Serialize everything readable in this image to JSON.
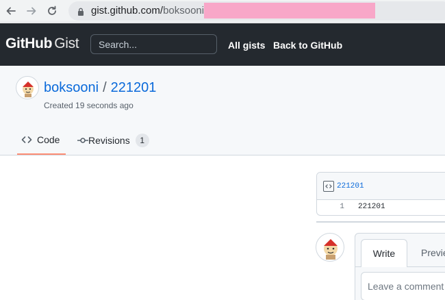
{
  "browser": {
    "url_domain": "gist.github.com/",
    "url_path": "boksooni/"
  },
  "header": {
    "logo_github": "GitHub",
    "logo_gist": "Gist",
    "search_placeholder": "Search...",
    "all_gists": "All gists",
    "back_to_github": "Back to GitHub"
  },
  "gist": {
    "owner": "boksooni",
    "separator": "/",
    "name": "221201",
    "created": "Created 19 seconds ago"
  },
  "tabs": {
    "code": "Code",
    "revisions": "Revisions",
    "revisions_count": "1"
  },
  "file": {
    "name": "221201",
    "lines": [
      {
        "num": "1",
        "code": "221201"
      }
    ]
  },
  "comment": {
    "write_tab": "Write",
    "preview_tab": "Preview",
    "placeholder": "Leave a comment"
  },
  "colors": {
    "header_bg": "#24292f",
    "link": "#0969da",
    "active_tab_underline": "#fd8c73",
    "redaction": "#f8a7c8"
  },
  "icons": [
    "back-arrow-icon",
    "forward-arrow-icon",
    "reload-icon",
    "lock-icon",
    "code-icon",
    "commit-icon",
    "file-code-icon"
  ]
}
